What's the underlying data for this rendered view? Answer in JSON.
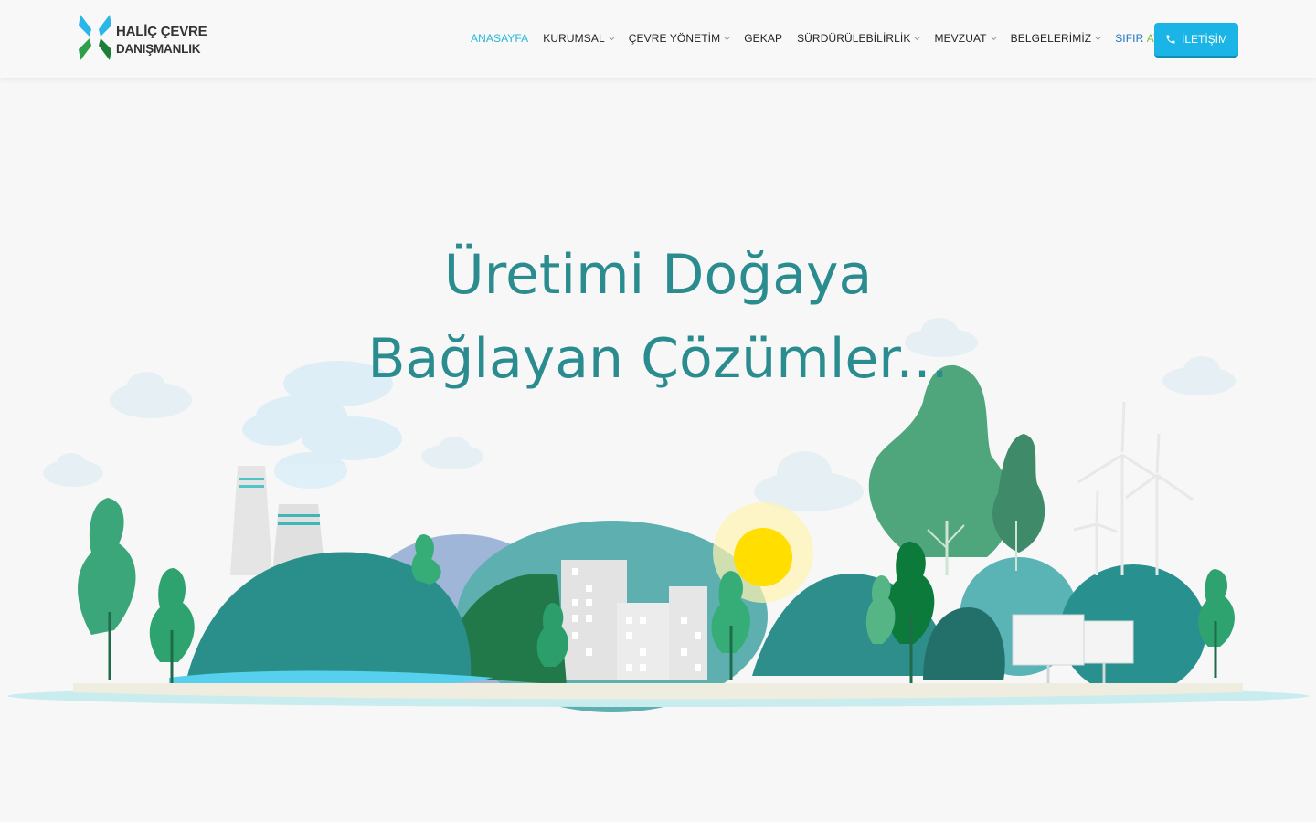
{
  "brand": {
    "line1": "HALİÇ ÇEVRE",
    "line2": "DANIŞMANLIK",
    "colors": {
      "blue": "#29b6e8",
      "green": "#2e9e4a"
    }
  },
  "nav": {
    "items": [
      {
        "label": "ANASAYFA",
        "active": true,
        "dropdown": false
      },
      {
        "label": "KURUMSAL",
        "active": false,
        "dropdown": true
      },
      {
        "label": "ÇEVRE YÖNETİM",
        "active": false,
        "dropdown": true
      },
      {
        "label": "GEKAP",
        "active": false,
        "dropdown": false
      },
      {
        "label": "SÜRDÜRÜLEBİLİRLİK",
        "active": false,
        "dropdown": true
      },
      {
        "label": "MEVZUAT",
        "active": false,
        "dropdown": true
      },
      {
        "label": "BELGELERİMİZ",
        "active": false,
        "dropdown": true
      }
    ],
    "sifir_a": "SIFIR",
    "sifir_b": "ATIK",
    "contact_label": "İLETİŞİM",
    "contact_icon": "phone-icon"
  },
  "hero": {
    "line1": "Üretimi Doğaya",
    "line2": "Bağlayan Çözümler...",
    "color": "#2b8c8f"
  },
  "illustration": {
    "icons": [
      "cloud-icon",
      "factory-icon",
      "tree-icon",
      "hill-icon",
      "building-icon",
      "sun-icon",
      "wind-turbine-icon",
      "solar-panel-icon"
    ]
  }
}
